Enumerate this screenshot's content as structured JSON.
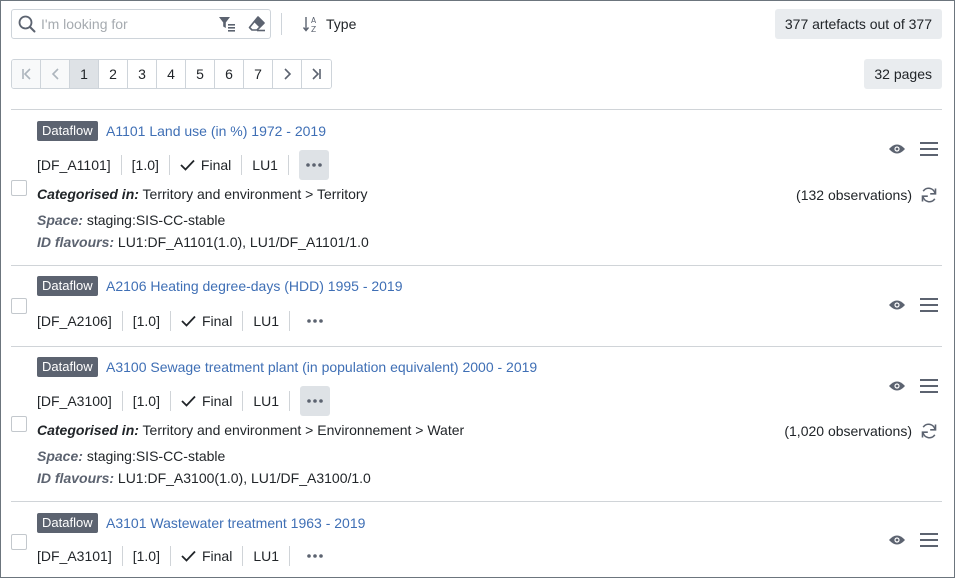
{
  "search": {
    "placeholder": "I'm looking for",
    "value": ""
  },
  "sort": {
    "label": "Type"
  },
  "summary": {
    "count_label": "377 artefacts out of 377",
    "pages_label": "32 pages"
  },
  "pagination": {
    "pages": [
      "1",
      "2",
      "3",
      "4",
      "5",
      "6",
      "7"
    ],
    "current": "1"
  },
  "items": [
    {
      "type": "Dataflow",
      "title": "A1101 Land use (in %) 1972 - 2019",
      "id": "[DF_A1101]",
      "version": "[1.0]",
      "status": "Final",
      "agency": "LU1",
      "categorised_label": "Categorised in:",
      "categorised": "Territory and environment > Territory",
      "space_label": "Space:",
      "space": "staging:SIS-CC-stable",
      "flavours_label": "ID flavours:",
      "flavours": "LU1:DF_A1101(1.0), LU1/DF_A1101/1.0",
      "observations": "(132 observations)"
    },
    {
      "type": "Dataflow",
      "title": "A2106 Heating degree-days (HDD) 1995 - 2019",
      "id": "[DF_A2106]",
      "version": "[1.0]",
      "status": "Final",
      "agency": "LU1"
    },
    {
      "type": "Dataflow",
      "title": "A3100 Sewage treatment plant (in population equivalent) 2000 - 2019",
      "id": "[DF_A3100]",
      "version": "[1.0]",
      "status": "Final",
      "agency": "LU1",
      "categorised_label": "Categorised in:",
      "categorised": "Territory and environment > Environnement > Water",
      "space_label": "Space:",
      "space": "staging:SIS-CC-stable",
      "flavours_label": "ID flavours:",
      "flavours": "LU1:DF_A3100(1.0), LU1/DF_A3100/1.0",
      "observations": "(1,020 observations)"
    },
    {
      "type": "Dataflow",
      "title": "A3101 Wastewater treatment 1963 - 2019",
      "id": "[DF_A3101]",
      "version": "[1.0]",
      "status": "Final",
      "agency": "LU1"
    }
  ],
  "colors": {
    "link": "#3f6fb5",
    "tag": "#5c6370",
    "badge": "#e9ecef",
    "active_page": "#dee2e6"
  }
}
